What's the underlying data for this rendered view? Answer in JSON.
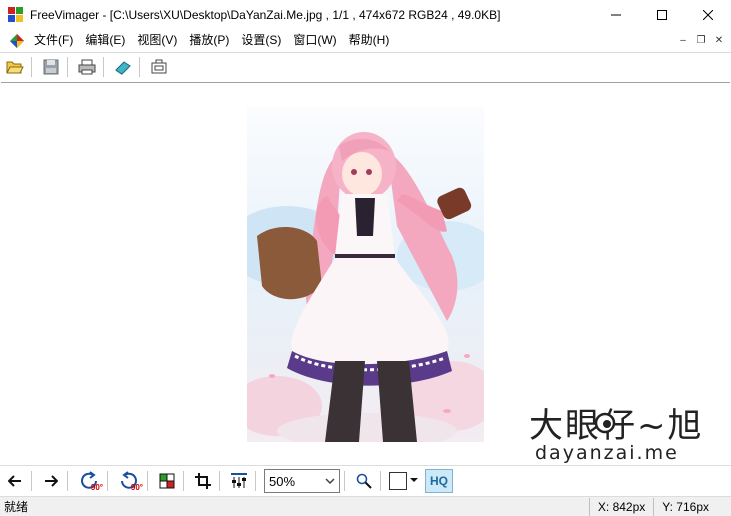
{
  "window": {
    "title": "FreeVimager - [C:\\Users\\XU\\Desktop\\DaYanZai.Me.jpg , 1/1 , 474x672 RGB24 , 49.0KB]",
    "controls": {
      "minimize": "—",
      "maximize": "☐",
      "close": "✕"
    }
  },
  "menu": {
    "items": [
      "文件(F)",
      "编辑(E)",
      "视图(V)",
      "播放(P)",
      "设置(S)",
      "窗口(W)",
      "帮助(H)"
    ],
    "mdi": {
      "minimize": "–",
      "restore": "❐",
      "close": "✕"
    }
  },
  "toolbar_top": {
    "icons": [
      "open-folder-icon",
      "save-icon",
      "print-icon",
      "scan-icon",
      "capture-icon"
    ]
  },
  "toolbar_bottom": {
    "icons": [
      "arrow-left-icon",
      "arrow-right-icon",
      "rotate-ccw-90-icon",
      "rotate-cw-90-icon",
      "color-palette-icon",
      "crop-icon",
      "adjust-icon",
      "zoom-icon"
    ],
    "rotate_ccw_label": "90°",
    "rotate_cw_label": "90°",
    "zoom_value": "50%",
    "hq_label": "HQ"
  },
  "status": {
    "text": "就绪",
    "x": "X: 842px",
    "y": "Y: 716px"
  },
  "watermark": {
    "logo_text": "大眼仔~旭",
    "domain": "dayanzai.me"
  },
  "colors": {
    "accent": "#1a6aa3",
    "hq_bg": "#cde8f6",
    "statusbar_bg": "#f0f0f0"
  }
}
